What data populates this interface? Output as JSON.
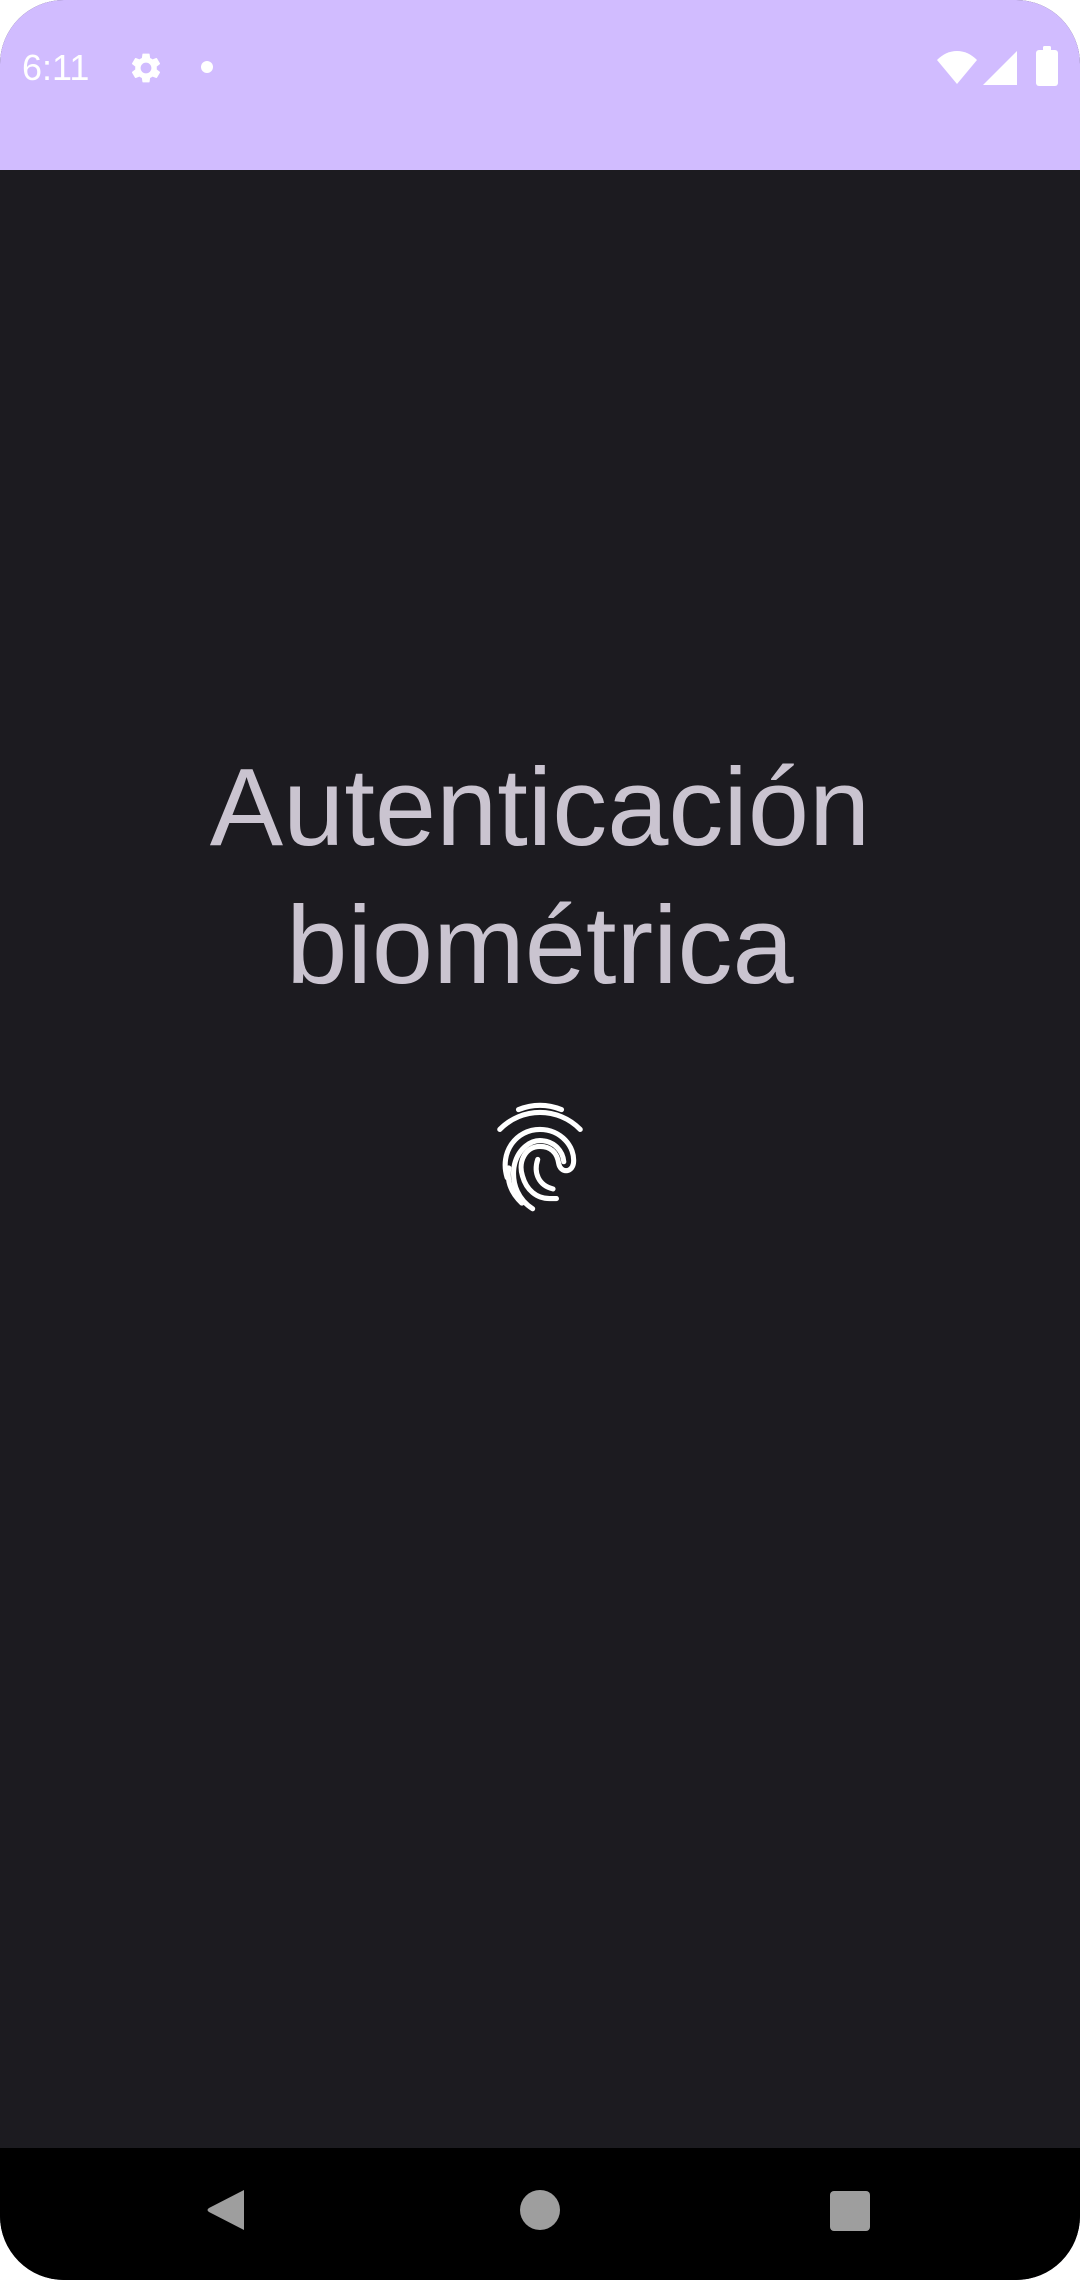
{
  "status_bar": {
    "time": "6:11",
    "background_color": "#d1bcff",
    "icons": [
      "settings-icon",
      "notification-dot-icon",
      "wifi-icon",
      "cellular-signal-icon",
      "battery-icon"
    ]
  },
  "main": {
    "title": "Autenticación biométrica",
    "icon": "fingerprint-icon",
    "background_color": "#1c1b20",
    "text_color": "#cac4d0"
  },
  "nav_bar": {
    "buttons": [
      "back-button",
      "home-button",
      "recents-button"
    ]
  }
}
